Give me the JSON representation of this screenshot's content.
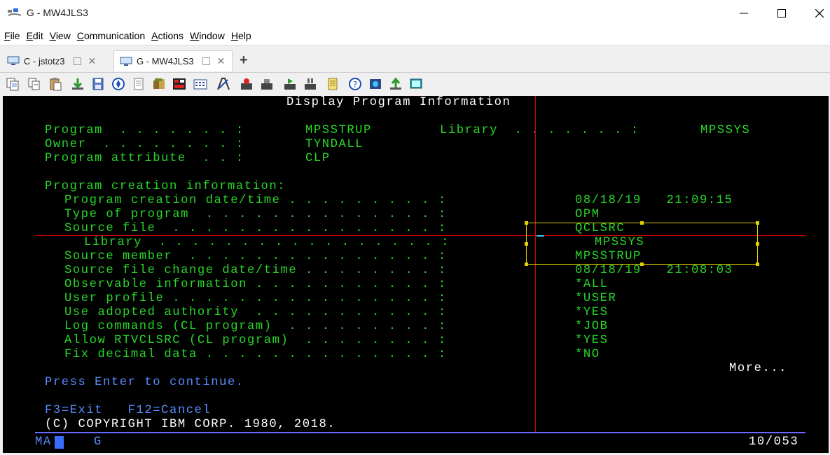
{
  "window": {
    "title": "G - MW4JLS3"
  },
  "menu": [
    {
      "pre": "",
      "u": "F",
      "post": "ile"
    },
    {
      "pre": "",
      "u": "E",
      "post": "dit"
    },
    {
      "pre": "",
      "u": "V",
      "post": "iew"
    },
    {
      "pre": "",
      "u": "C",
      "post": "ommunication"
    },
    {
      "pre": "",
      "u": "A",
      "post": "ctions"
    },
    {
      "pre": "",
      "u": "W",
      "post": "indow"
    },
    {
      "pre": "",
      "u": "H",
      "post": "elp"
    }
  ],
  "tabs": [
    {
      "label": "C - jstotz3"
    },
    {
      "label": "G - MW4JLS3"
    }
  ],
  "toolbar_icons": [
    "copy-icon",
    "copy-append-icon",
    "paste-icon",
    "receive-file-icon",
    "save-icon",
    "navigate-icon",
    "print-icon",
    "macro-icon",
    "record-icon",
    "keypad-icon",
    "edit-keypad-icon",
    "run-icon",
    "stop-icon",
    "play-icon",
    "pause-icon",
    "notes-icon",
    "help-icon",
    "settings-icon",
    "send-file-icon",
    "screen-icon"
  ],
  "screen": {
    "title": "Display Program Information",
    "program": {
      "label": "Program  . . . . . . . :",
      "value": "MPSSTRUP"
    },
    "library": {
      "label": "Library  . . . . . . . :",
      "value": "MPSSYS"
    },
    "owner": {
      "label": "Owner  . . . . . . . . :",
      "value": "TYNDALL"
    },
    "attribute": {
      "label": "Program attribute  . . :",
      "value": "CLP"
    },
    "section": "Program creation information:",
    "rows": [
      {
        "label": "Program creation date/time . . . . . . . . . :",
        "value": "08/18/19   21:09:15",
        "indent": 1
      },
      {
        "label": "Type of program  . . . . . . . . . . . . . . :",
        "value": "OPM",
        "indent": 1
      },
      {
        "label": "Source file  . . . . . . . . . . . . . . . . :",
        "value": "QCLSRC",
        "indent": 1
      },
      {
        "label": "Library  . . . . . . . . . . . . . . . . . :",
        "value": "MPSSYS",
        "indent": 2
      },
      {
        "label": "Source member  . . . . . . . . . . . . . . . :",
        "value": "MPSSTRUP",
        "indent": 1
      },
      {
        "label": "Source file change date/time . . . . . . . . :",
        "value": "08/18/19   21:08:03",
        "indent": 1
      },
      {
        "label": "Observable information . . . . . . . . . . . :",
        "value": "*ALL",
        "indent": 1
      },
      {
        "label": "User profile . . . . . . . . . . . . . . . . :",
        "value": "*USER",
        "indent": 1
      },
      {
        "label": "Use adopted authority  . . . . . . . . . . . :",
        "value": "*YES",
        "indent": 1
      },
      {
        "label": "Log commands (CL program)  . . . . . . . . . :",
        "value": "*JOB",
        "indent": 1
      },
      {
        "label": "Allow RTVCLSRC (CL program)  . . . . . . . . :",
        "value": "*YES",
        "indent": 1
      },
      {
        "label": "Fix decimal data . . . . . . . . . . . . . . :",
        "value": "*NO",
        "indent": 1
      }
    ],
    "more": "More...",
    "instruction": "Press Enter to continue.",
    "fkeys": "F3=Exit   F12=Cancel",
    "copyright": "(C) COPYRIGHT IBM CORP. 1980, 2018.",
    "oia_status": "MA",
    "oia_session": "G",
    "cursor_pos": "10/053"
  }
}
